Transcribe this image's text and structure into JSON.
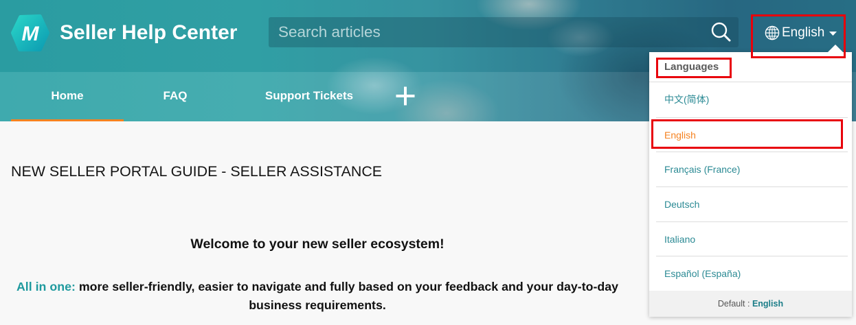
{
  "colors": {
    "accent": "#f58220",
    "brand_teal": "#1f9a9e",
    "link": "#2b8a94",
    "highlight": "#e8000b"
  },
  "icons": {
    "logo": "logo-icon",
    "search": "search-icon",
    "language": "globe-icon",
    "language_caret": "caret-down-icon",
    "add": "plus-icon"
  },
  "brand": {
    "logo_letter": "M",
    "title": "Seller Help Center"
  },
  "search": {
    "placeholder": "Search articles"
  },
  "language_button": {
    "label": "English"
  },
  "nav": {
    "items": [
      {
        "label": "Home",
        "active": true
      },
      {
        "label": "FAQ",
        "active": false
      },
      {
        "label": "Support Tickets",
        "active": false
      }
    ]
  },
  "article": {
    "title": "NEW SELLER PORTAL GUIDE - SELLER ASSISTANCE",
    "heading": "Welcome to your new seller ecosystem!",
    "lead": "All in one:",
    "body_line1": "more seller-friendly, easier to navigate and fully based on your feedback and your day-to-day",
    "body_line2": "business requirements."
  },
  "language_menu": {
    "header": "Languages",
    "options": [
      {
        "label": "中文(简体)",
        "selected": false
      },
      {
        "label": "English",
        "selected": true
      },
      {
        "label": "Français (France)",
        "selected": false
      },
      {
        "label": "Deutsch",
        "selected": false
      },
      {
        "label": "Italiano",
        "selected": false
      },
      {
        "label": "Español (España)",
        "selected": false
      }
    ],
    "default_label": "Default :",
    "default_value": "English"
  }
}
